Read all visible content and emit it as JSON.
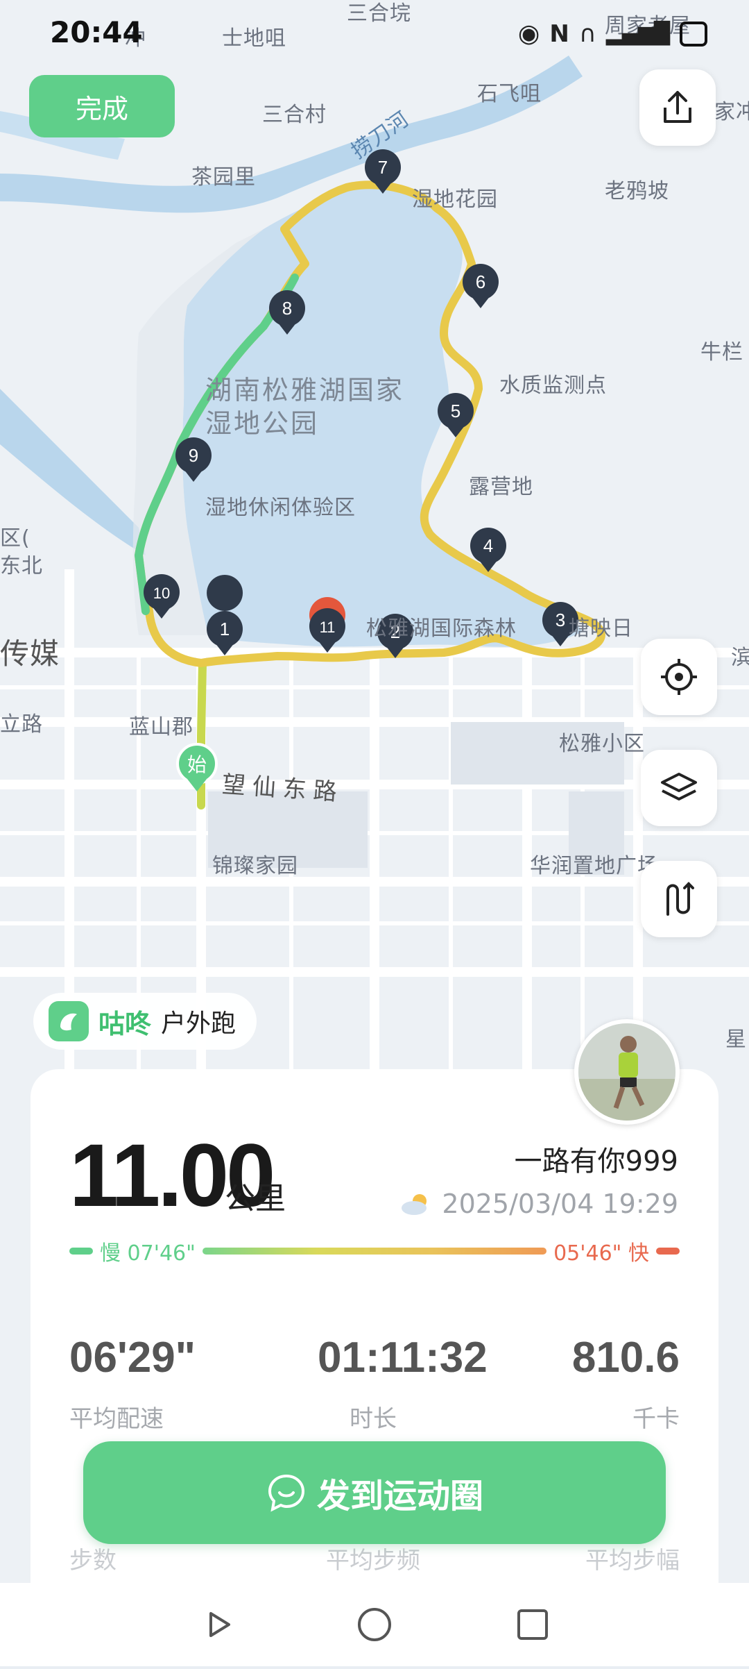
{
  "status": {
    "time": "20:44"
  },
  "top": {
    "done_label": "完成"
  },
  "map": {
    "labels": {
      "l1": "士地咀",
      "l2": "三合村",
      "l3": "茶园里",
      "l4": "湿地花园",
      "l5": "石飞咀",
      "l6": "老鸦坡",
      "l7": "水质监测点",
      "l8": "露营地",
      "l9": "湿地休闲体验区",
      "l10": "松雅湖国际森林",
      "l11": "塘映日",
      "l12": "蓝山郡",
      "l13": "松雅小区",
      "l14": "锦璨家园",
      "l15": "华润置地广场",
      "l16": "传媒",
      "l17": "立路",
      "l18": "捞刀河",
      "l19": "牛栏",
      "l20": "星",
      "park": "湖南松雅湖国家湿地公园",
      "road": "望仙东路",
      "top1": "冲",
      "top2": "三合垸",
      "top3": "周家老屋",
      "top4": "家冲",
      "left1": "区(",
      "left2": "东北",
      "left3": "滨"
    },
    "start_label": "始",
    "route_colors": {
      "green": "#5fcf8a",
      "yellow": "#e8c94a",
      "orange": "#e9b04d"
    },
    "km_markers": [
      "1",
      "2",
      "3",
      "4",
      "5",
      "6",
      "7",
      "8",
      "9",
      "10",
      "11"
    ]
  },
  "app": {
    "name": "咕咚",
    "sport": "户外跑"
  },
  "summary": {
    "distance": "11.00",
    "unit": "公里",
    "username": "一路有你999",
    "datetime": "2025/03/04 19:29",
    "pace_slow": "慢 07'46\"",
    "pace_fast": "05'46\" 快",
    "stats": [
      {
        "value": "06'29\"",
        "label": "平均配速"
      },
      {
        "value": "01:11:32",
        "label": "时长"
      },
      {
        "value": "810.6",
        "label": "千卡"
      }
    ],
    "ghost_stats": [
      "步数",
      "平均步频",
      "平均步幅"
    ]
  },
  "share": {
    "label": "发到运动圈"
  }
}
